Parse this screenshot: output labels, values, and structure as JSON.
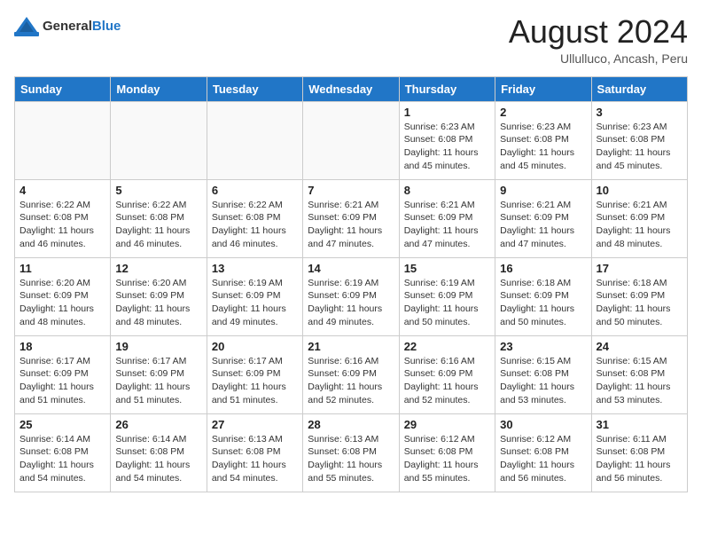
{
  "header": {
    "logo_general": "General",
    "logo_blue": "Blue",
    "month_year": "August 2024",
    "location": "Ullulluco, Ancash, Peru"
  },
  "days_of_week": [
    "Sunday",
    "Monday",
    "Tuesday",
    "Wednesday",
    "Thursday",
    "Friday",
    "Saturday"
  ],
  "weeks": [
    [
      {
        "day": "",
        "info": ""
      },
      {
        "day": "",
        "info": ""
      },
      {
        "day": "",
        "info": ""
      },
      {
        "day": "",
        "info": ""
      },
      {
        "day": "1",
        "info": "Sunrise: 6:23 AM\nSunset: 6:08 PM\nDaylight: 11 hours and 45 minutes."
      },
      {
        "day": "2",
        "info": "Sunrise: 6:23 AM\nSunset: 6:08 PM\nDaylight: 11 hours and 45 minutes."
      },
      {
        "day": "3",
        "info": "Sunrise: 6:23 AM\nSunset: 6:08 PM\nDaylight: 11 hours and 45 minutes."
      }
    ],
    [
      {
        "day": "4",
        "info": "Sunrise: 6:22 AM\nSunset: 6:08 PM\nDaylight: 11 hours and 46 minutes."
      },
      {
        "day": "5",
        "info": "Sunrise: 6:22 AM\nSunset: 6:08 PM\nDaylight: 11 hours and 46 minutes."
      },
      {
        "day": "6",
        "info": "Sunrise: 6:22 AM\nSunset: 6:08 PM\nDaylight: 11 hours and 46 minutes."
      },
      {
        "day": "7",
        "info": "Sunrise: 6:21 AM\nSunset: 6:09 PM\nDaylight: 11 hours and 47 minutes."
      },
      {
        "day": "8",
        "info": "Sunrise: 6:21 AM\nSunset: 6:09 PM\nDaylight: 11 hours and 47 minutes."
      },
      {
        "day": "9",
        "info": "Sunrise: 6:21 AM\nSunset: 6:09 PM\nDaylight: 11 hours and 47 minutes."
      },
      {
        "day": "10",
        "info": "Sunrise: 6:21 AM\nSunset: 6:09 PM\nDaylight: 11 hours and 48 minutes."
      }
    ],
    [
      {
        "day": "11",
        "info": "Sunrise: 6:20 AM\nSunset: 6:09 PM\nDaylight: 11 hours and 48 minutes."
      },
      {
        "day": "12",
        "info": "Sunrise: 6:20 AM\nSunset: 6:09 PM\nDaylight: 11 hours and 48 minutes."
      },
      {
        "day": "13",
        "info": "Sunrise: 6:19 AM\nSunset: 6:09 PM\nDaylight: 11 hours and 49 minutes."
      },
      {
        "day": "14",
        "info": "Sunrise: 6:19 AM\nSunset: 6:09 PM\nDaylight: 11 hours and 49 minutes."
      },
      {
        "day": "15",
        "info": "Sunrise: 6:19 AM\nSunset: 6:09 PM\nDaylight: 11 hours and 50 minutes."
      },
      {
        "day": "16",
        "info": "Sunrise: 6:18 AM\nSunset: 6:09 PM\nDaylight: 11 hours and 50 minutes."
      },
      {
        "day": "17",
        "info": "Sunrise: 6:18 AM\nSunset: 6:09 PM\nDaylight: 11 hours and 50 minutes."
      }
    ],
    [
      {
        "day": "18",
        "info": "Sunrise: 6:17 AM\nSunset: 6:09 PM\nDaylight: 11 hours and 51 minutes."
      },
      {
        "day": "19",
        "info": "Sunrise: 6:17 AM\nSunset: 6:09 PM\nDaylight: 11 hours and 51 minutes."
      },
      {
        "day": "20",
        "info": "Sunrise: 6:17 AM\nSunset: 6:09 PM\nDaylight: 11 hours and 51 minutes."
      },
      {
        "day": "21",
        "info": "Sunrise: 6:16 AM\nSunset: 6:09 PM\nDaylight: 11 hours and 52 minutes."
      },
      {
        "day": "22",
        "info": "Sunrise: 6:16 AM\nSunset: 6:09 PM\nDaylight: 11 hours and 52 minutes."
      },
      {
        "day": "23",
        "info": "Sunrise: 6:15 AM\nSunset: 6:08 PM\nDaylight: 11 hours and 53 minutes."
      },
      {
        "day": "24",
        "info": "Sunrise: 6:15 AM\nSunset: 6:08 PM\nDaylight: 11 hours and 53 minutes."
      }
    ],
    [
      {
        "day": "25",
        "info": "Sunrise: 6:14 AM\nSunset: 6:08 PM\nDaylight: 11 hours and 54 minutes."
      },
      {
        "day": "26",
        "info": "Sunrise: 6:14 AM\nSunset: 6:08 PM\nDaylight: 11 hours and 54 minutes."
      },
      {
        "day": "27",
        "info": "Sunrise: 6:13 AM\nSunset: 6:08 PM\nDaylight: 11 hours and 54 minutes."
      },
      {
        "day": "28",
        "info": "Sunrise: 6:13 AM\nSunset: 6:08 PM\nDaylight: 11 hours and 55 minutes."
      },
      {
        "day": "29",
        "info": "Sunrise: 6:12 AM\nSunset: 6:08 PM\nDaylight: 11 hours and 55 minutes."
      },
      {
        "day": "30",
        "info": "Sunrise: 6:12 AM\nSunset: 6:08 PM\nDaylight: 11 hours and 56 minutes."
      },
      {
        "day": "31",
        "info": "Sunrise: 6:11 AM\nSunset: 6:08 PM\nDaylight: 11 hours and 56 minutes."
      }
    ]
  ]
}
